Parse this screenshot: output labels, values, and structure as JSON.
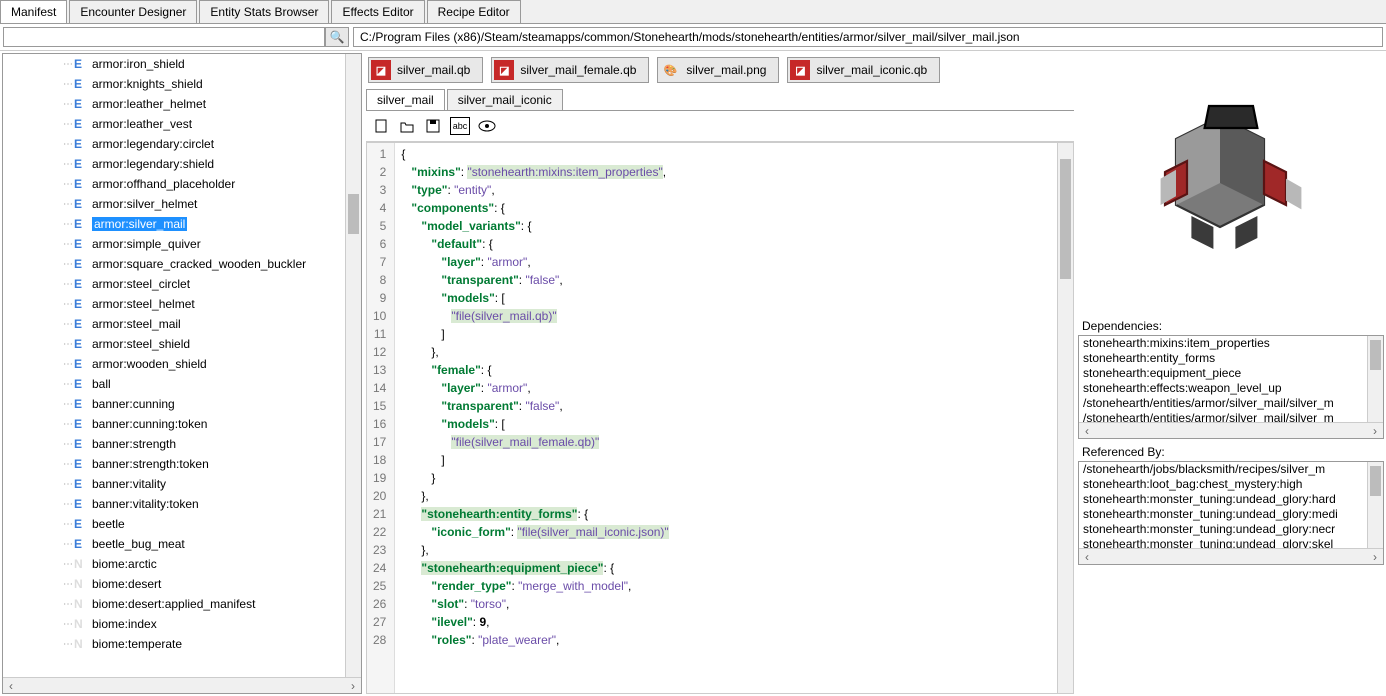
{
  "tabs": [
    "Manifest",
    "Encounter Designer",
    "Entity Stats Browser",
    "Effects Editor",
    "Recipe Editor"
  ],
  "activeTab": 0,
  "searchValue": "",
  "path": "C:/Program Files (x86)/Steam/steamapps/common/Stonehearth/mods/stonehearth/entities/armor/silver_mail/silver_mail.json",
  "tree": [
    {
      "icon": "E",
      "label": "armor:iron_shield"
    },
    {
      "icon": "E",
      "label": "armor:knights_shield"
    },
    {
      "icon": "E",
      "label": "armor:leather_helmet"
    },
    {
      "icon": "E",
      "label": "armor:leather_vest"
    },
    {
      "icon": "E",
      "label": "armor:legendary:circlet"
    },
    {
      "icon": "E",
      "label": "armor:legendary:shield"
    },
    {
      "icon": "E",
      "label": "armor:offhand_placeholder"
    },
    {
      "icon": "E",
      "label": "armor:silver_helmet"
    },
    {
      "icon": "E",
      "label": "armor:silver_mail",
      "selected": true
    },
    {
      "icon": "E",
      "label": "armor:simple_quiver"
    },
    {
      "icon": "E",
      "label": "armor:square_cracked_wooden_buckler"
    },
    {
      "icon": "E",
      "label": "armor:steel_circlet"
    },
    {
      "icon": "E",
      "label": "armor:steel_helmet"
    },
    {
      "icon": "E",
      "label": "armor:steel_mail"
    },
    {
      "icon": "E",
      "label": "armor:steel_shield"
    },
    {
      "icon": "E",
      "label": "armor:wooden_shield"
    },
    {
      "icon": "E",
      "label": "ball"
    },
    {
      "icon": "E",
      "label": "banner:cunning"
    },
    {
      "icon": "E",
      "label": "banner:cunning:token"
    },
    {
      "icon": "E",
      "label": "banner:strength"
    },
    {
      "icon": "E",
      "label": "banner:strength:token"
    },
    {
      "icon": "E",
      "label": "banner:vitality"
    },
    {
      "icon": "E",
      "label": "banner:vitality:token"
    },
    {
      "icon": "E",
      "label": "beetle"
    },
    {
      "icon": "E",
      "label": "beetle_bug_meat"
    },
    {
      "icon": "N",
      "label": "biome:arctic"
    },
    {
      "icon": "N",
      "label": "biome:desert"
    },
    {
      "icon": "N",
      "label": "biome:desert:applied_manifest"
    },
    {
      "icon": "N",
      "label": "biome:index"
    },
    {
      "icon": "N",
      "label": "biome:temperate"
    }
  ],
  "fileButtons": [
    {
      "label": "silver_mail.qb",
      "icon": "qb"
    },
    {
      "label": "silver_mail_female.qb",
      "icon": "qb"
    },
    {
      "label": "silver_mail.png",
      "icon": "img"
    },
    {
      "label": "silver_mail_iconic.qb",
      "icon": "qb"
    }
  ],
  "editorTabs": [
    "silver_mail",
    "silver_mail_iconic"
  ],
  "activeEditorTab": 0,
  "toolbarIcons": [
    "new",
    "open",
    "save",
    "abc",
    "eye"
  ],
  "code": [
    {
      "n": 1,
      "html": "{"
    },
    {
      "n": 2,
      "html": "   <span class='k'>\"mixins\"</span>: <span class='s hl'>\"stonehearth:mixins:item_properties\"</span>,"
    },
    {
      "n": 3,
      "html": "   <span class='k'>\"type\"</span>: <span class='s'>\"entity\"</span>,"
    },
    {
      "n": 4,
      "html": "   <span class='k'>\"components\"</span>: {"
    },
    {
      "n": 5,
      "html": "      <span class='k'>\"model_variants\"</span>: {"
    },
    {
      "n": 6,
      "html": "         <span class='k'>\"default\"</span>: {"
    },
    {
      "n": 7,
      "html": "            <span class='k'>\"layer\"</span>: <span class='s'>\"armor\"</span>,"
    },
    {
      "n": 8,
      "html": "            <span class='k'>\"transparent\"</span>: <span class='s'>\"false\"</span>,"
    },
    {
      "n": 9,
      "html": "            <span class='k'>\"models\"</span>: ["
    },
    {
      "n": 10,
      "html": "               <span class='s hl'>\"file(silver_mail.qb)\"</span>"
    },
    {
      "n": 11,
      "html": "            ]"
    },
    {
      "n": 12,
      "html": "         },"
    },
    {
      "n": 13,
      "html": "         <span class='k'>\"female\"</span>: {"
    },
    {
      "n": 14,
      "html": "            <span class='k'>\"layer\"</span>: <span class='s'>\"armor\"</span>,"
    },
    {
      "n": 15,
      "html": "            <span class='k'>\"transparent\"</span>: <span class='s'>\"false\"</span>,"
    },
    {
      "n": 16,
      "html": "            <span class='k'>\"models\"</span>: ["
    },
    {
      "n": 17,
      "html": "               <span class='s hl'>\"file(silver_mail_female.qb)\"</span>"
    },
    {
      "n": 18,
      "html": "            ]"
    },
    {
      "n": 19,
      "html": "         }"
    },
    {
      "n": 20,
      "html": "      },"
    },
    {
      "n": 21,
      "html": "      <span class='k hl'>\"stonehearth:entity_forms\"</span>: {"
    },
    {
      "n": 22,
      "html": "         <span class='k'>\"iconic_form\"</span>: <span class='s hl'>\"file(silver_mail_iconic.json)\"</span>"
    },
    {
      "n": 23,
      "html": "      },"
    },
    {
      "n": 24,
      "html": "      <span class='k hl'>\"stonehearth:equipment_piece\"</span>: {"
    },
    {
      "n": 25,
      "html": "         <span class='k'>\"render_type\"</span>: <span class='s'>\"merge_with_model\"</span>,"
    },
    {
      "n": 26,
      "html": "         <span class='k'>\"slot\"</span>: <span class='s'>\"torso\"</span>,"
    },
    {
      "n": 27,
      "html": "         <span class='k'>\"ilevel\"</span>: <span class='n'>9</span>,"
    },
    {
      "n": 28,
      "html": "         <span class='k'>\"roles\"</span>: <span class='s'>\"plate_wearer\"</span>,"
    }
  ],
  "dependenciesTitle": "Dependencies:",
  "dependencies": [
    "stonehearth:mixins:item_properties",
    "stonehearth:entity_forms",
    "stonehearth:equipment_piece",
    "stonehearth:effects:weapon_level_up",
    "/stonehearth/entities/armor/silver_mail/silver_m",
    "/stonehearth/entities/armor/silver_mail/silver_m"
  ],
  "referencedByTitle": "Referenced By:",
  "referencedBy": [
    "/stonehearth/jobs/blacksmith/recipes/silver_m",
    "stonehearth:loot_bag:chest_mystery:high",
    "stonehearth:monster_tuning:undead_glory:hard",
    "stonehearth:monster_tuning:undead_glory:medi",
    "stonehearth:monster_tuning:undead_glory:necr",
    "stonehearth:monster_tuning:undead_glory:skel"
  ]
}
